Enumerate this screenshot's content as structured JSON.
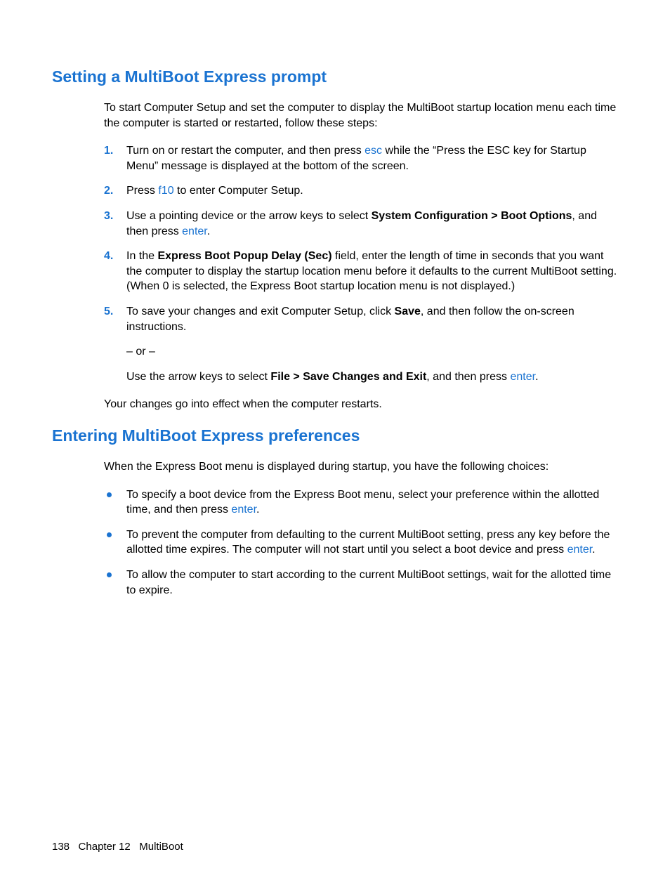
{
  "section1": {
    "heading": "Setting a MultiBoot Express prompt",
    "intro": "To start Computer Setup and set the computer to display the MultiBoot startup location menu each time the computer is started or restarted, follow these steps:",
    "steps": {
      "s1_a": "Turn on or restart the computer, and then press ",
      "s1_key": "esc",
      "s1_b": " while the “Press the ESC key for Startup Menu” message is displayed at the bottom of the screen.",
      "s2_a": "Press ",
      "s2_key": "f10",
      "s2_b": " to enter Computer Setup.",
      "s3_a": "Use a pointing device or the arrow keys to select ",
      "s3_bold": "System Configuration > Boot Options",
      "s3_b": ", and then press ",
      "s3_key": "enter",
      "s3_c": ".",
      "s4_a": "In the ",
      "s4_bold": "Express Boot Popup Delay (Sec)",
      "s4_b": " field, enter the length of time in seconds that you want the computer to display the startup location menu before it defaults to the current MultiBoot setting. (When 0 is selected, the Express Boot startup location menu is not displayed.)",
      "s5_a": "To save your changes and exit Computer Setup, click ",
      "s5_bold1": "Save",
      "s5_b": ", and then follow the on-screen instructions.",
      "s5_or": "– or –",
      "s5_c": "Use the arrow keys to select ",
      "s5_bold2": "File > Save Changes and Exit",
      "s5_d": ", and then press ",
      "s5_key": "enter",
      "s5_e": "."
    },
    "outro": "Your changes go into effect when the computer restarts."
  },
  "section2": {
    "heading": "Entering MultiBoot Express preferences",
    "intro": "When the Express Boot menu is displayed during startup, you have the following choices:",
    "bullets": {
      "b1_a": "To specify a boot device from the Express Boot menu, select your preference within the allotted time, and then press ",
      "b1_key": "enter",
      "b1_b": ".",
      "b2_a": "To prevent the computer from defaulting to the current MultiBoot setting, press any key before the allotted time expires. The computer will not start until you select a boot device and press ",
      "b2_key": "enter",
      "b2_b": ".",
      "b3": "To allow the computer to start according to the current MultiBoot settings, wait for the allotted time to expire."
    }
  },
  "footer": {
    "page": "138",
    "chapter": "Chapter 12   MultiBoot"
  },
  "nums": {
    "n1": "1.",
    "n2": "2.",
    "n3": "3.",
    "n4": "4.",
    "n5": "5."
  }
}
